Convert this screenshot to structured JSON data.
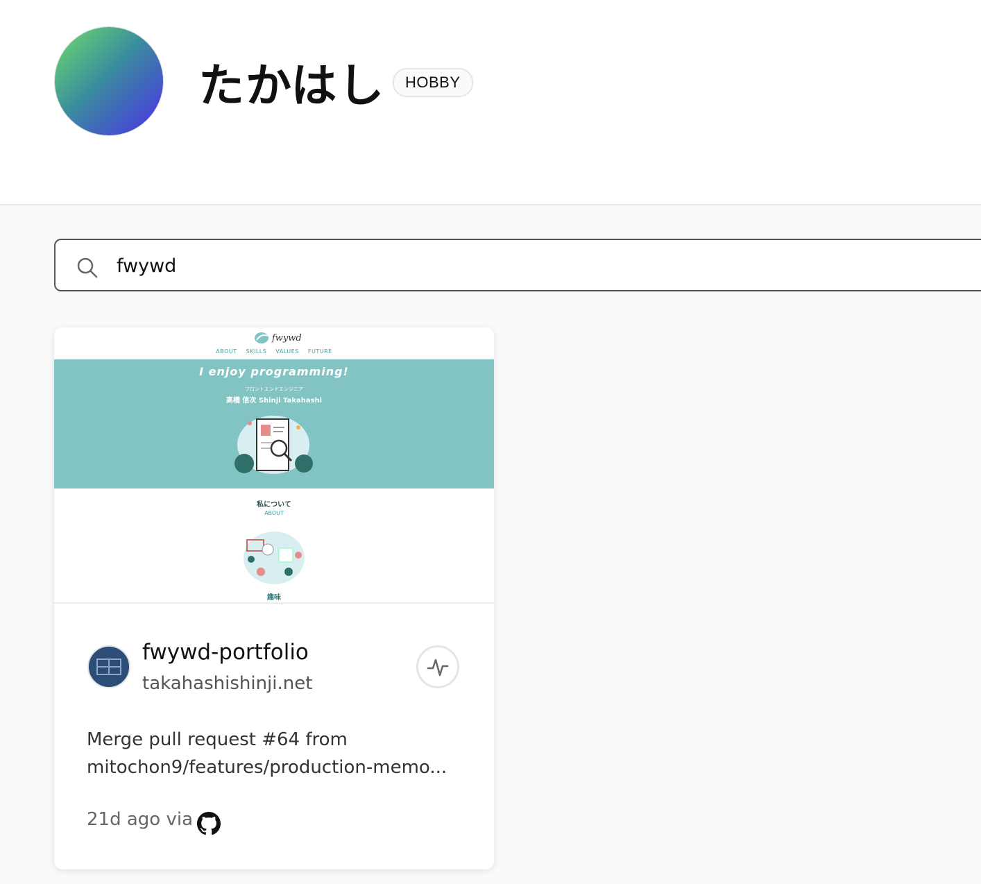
{
  "team": {
    "name": "たかはし",
    "plan": "HOBBY"
  },
  "search": {
    "value": "fwywd"
  },
  "project": {
    "preview": {
      "logo_text": "fwywd",
      "nav": [
        "ABOUT",
        "SKILLS",
        "VALUES",
        "FUTURE"
      ],
      "headline": "I enjoy programming!",
      "role": "フロントエンドエンジニア",
      "person": "高橋 信次 Shinji Takahashi",
      "about_jp": "私について",
      "about_en": "ABOUT",
      "hobby": "趣味",
      "hero_color": "#82c3c4"
    },
    "name": "fwywd-portfolio",
    "domain": "takahashishinji.net",
    "commit_line1": "Merge pull request #64 from",
    "commit_line2": "mitochon9/features/production-memo...",
    "time": "21d ago via",
    "source_icon": "github-icon",
    "activity_icon": "activity-icon"
  }
}
